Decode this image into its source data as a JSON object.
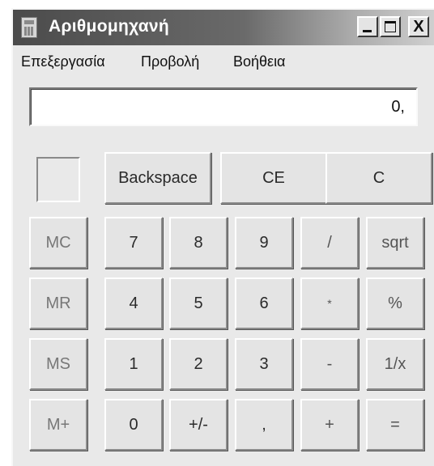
{
  "window": {
    "title": "Αριθμομηχανή",
    "controls": {
      "minimize": "_",
      "maximize": "□",
      "close": "X"
    }
  },
  "menu": [
    "Επεξεργασία",
    "Προβολή",
    "Βοήθεια"
  ],
  "display": {
    "value": "0,"
  },
  "memory_indicator": "",
  "buttons": {
    "backspace": "Backspace",
    "ce": "CE",
    "c": "C",
    "mc": "MC",
    "mr": "MR",
    "ms": "MS",
    "m_plus": "M+",
    "d7": "7",
    "d8": "8",
    "d9": "9",
    "d4": "4",
    "d5": "5",
    "d6": "6",
    "d1": "1",
    "d2": "2",
    "d3": "3",
    "d0": "0",
    "sign": "+/-",
    "decimal": ",",
    "divide": "/",
    "multiply": "*",
    "subtract": "-",
    "add": "+",
    "sqrt": "sqrt",
    "percent": "%",
    "reciprocal": "1/x",
    "equals": "="
  }
}
